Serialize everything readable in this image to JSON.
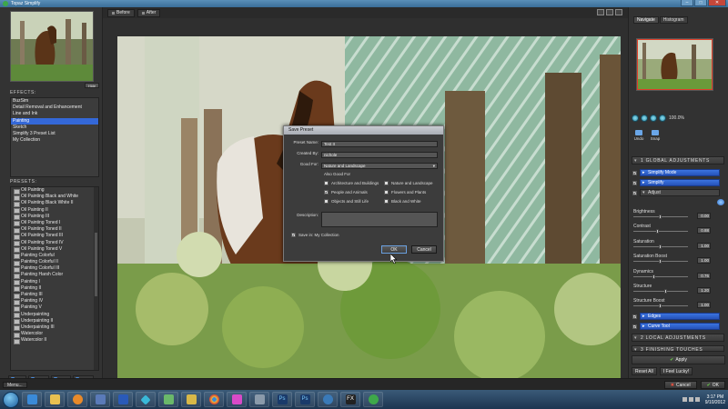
{
  "window": {
    "title": "Topaz Simplify",
    "minimize": "–",
    "maximize": "□",
    "close": "✕"
  },
  "thumbnail": {
    "hide_label": "Hide"
  },
  "effects": {
    "label": "EFFECTS:",
    "items": [
      {
        "label": "BuzSim",
        "selected": false
      },
      {
        "label": "Detail Removal and Enhancement",
        "selected": false
      },
      {
        "label": "Line and Ink",
        "selected": false
      },
      {
        "label": "Painting",
        "selected": true
      },
      {
        "label": "Sketch",
        "selected": false
      },
      {
        "label": "Simplify 3 Preset List",
        "selected": false
      },
      {
        "label": "My Collection",
        "selected": false
      }
    ]
  },
  "presets": {
    "label": "PRESETS:",
    "items": [
      "Oil Painting",
      "Oil Painting Black and White",
      "Oil Painting Black White II",
      "Oil Painting II",
      "Oil Painting III",
      "Oil Painting Toned I",
      "Oil Painting Toned II",
      "Oil Painting Toned III",
      "Oil Painting Toned IV",
      "Oil Painting Toned V",
      "Painting Colorful",
      "Painting Colorful II",
      "Painting Colorful III",
      "Painting Harsh Color",
      "Painting I",
      "Painting II",
      "Painting III",
      "Painting IV",
      "Painting V",
      "Underpainting",
      "Underpainting II",
      "Underpainting III",
      "Watercolor",
      "Watercolor II"
    ]
  },
  "left_buttons": [
    "Save",
    "Delete",
    "Import",
    "Export"
  ],
  "view_tabs": {
    "before": "Before",
    "after": "After"
  },
  "dialog": {
    "title": "Save Preset",
    "preset_name_label": "Preset Name:",
    "preset_name_value": "Test II",
    "created_by_label": "Created By:",
    "created_by_value": "nichole",
    "good_for_label": "Good For:",
    "good_for_value": "Nature and Landscape",
    "also_good_for_label": "Also Good For",
    "categories": [
      {
        "label": "Architecture and Buildings",
        "checked": false
      },
      {
        "label": "Nature and Landscape",
        "checked": false
      },
      {
        "label": "People and Animals",
        "checked": true
      },
      {
        "label": "Flowers and Plants",
        "checked": false
      },
      {
        "label": "Objects and Still Life",
        "checked": false
      },
      {
        "label": "Black and White",
        "checked": false
      }
    ],
    "description_label": "Description:",
    "save_in_label": "Save in: My Collection",
    "ok_label": "OK",
    "cancel_label": "Cancel"
  },
  "right": {
    "tabs": [
      "Navigate",
      "Histogram"
    ],
    "zoom_value": "100.0%",
    "undo_label": "Undo",
    "snap_label": "Snap",
    "global_header": "1  GLOBAL ADJUSTMENTS",
    "simplify_mode": "Simplify Mode",
    "simplify": "Simplify",
    "adjust": "Adjust",
    "sliders": [
      {
        "label": "Brightness",
        "value": "0.00",
        "fraction": 0.5
      },
      {
        "label": "Contrast",
        "value": "0.88",
        "fraction": 0.45
      },
      {
        "label": "Saturation",
        "value": "1.00",
        "fraction": 0.5
      },
      {
        "label": "Saturation Boost",
        "value": "1.00",
        "fraction": 0.5
      },
      {
        "label": "Dynamics",
        "value": "0.76",
        "fraction": 0.38
      },
      {
        "label": "Structure",
        "value": "1.20",
        "fraction": 0.6
      },
      {
        "label": "Structure Boost",
        "value": "1.00",
        "fraction": 0.5
      }
    ],
    "edges": "Edges",
    "curve_tool": "Curve Tool",
    "local_header": "2  LOCAL ADJUSTMENTS",
    "finishing_header": "3  FINISHING TOUCHES",
    "apply_label": "Apply",
    "reset_all_label": "Reset All",
    "lucky_label": "I Feel Lucky!"
  },
  "bottom": {
    "menu_label": "Menu...",
    "cancel_label": "Cancel",
    "ok_label": "OK"
  },
  "taskbar": {
    "time": "3:17 PM",
    "date": "9/10/2012"
  }
}
